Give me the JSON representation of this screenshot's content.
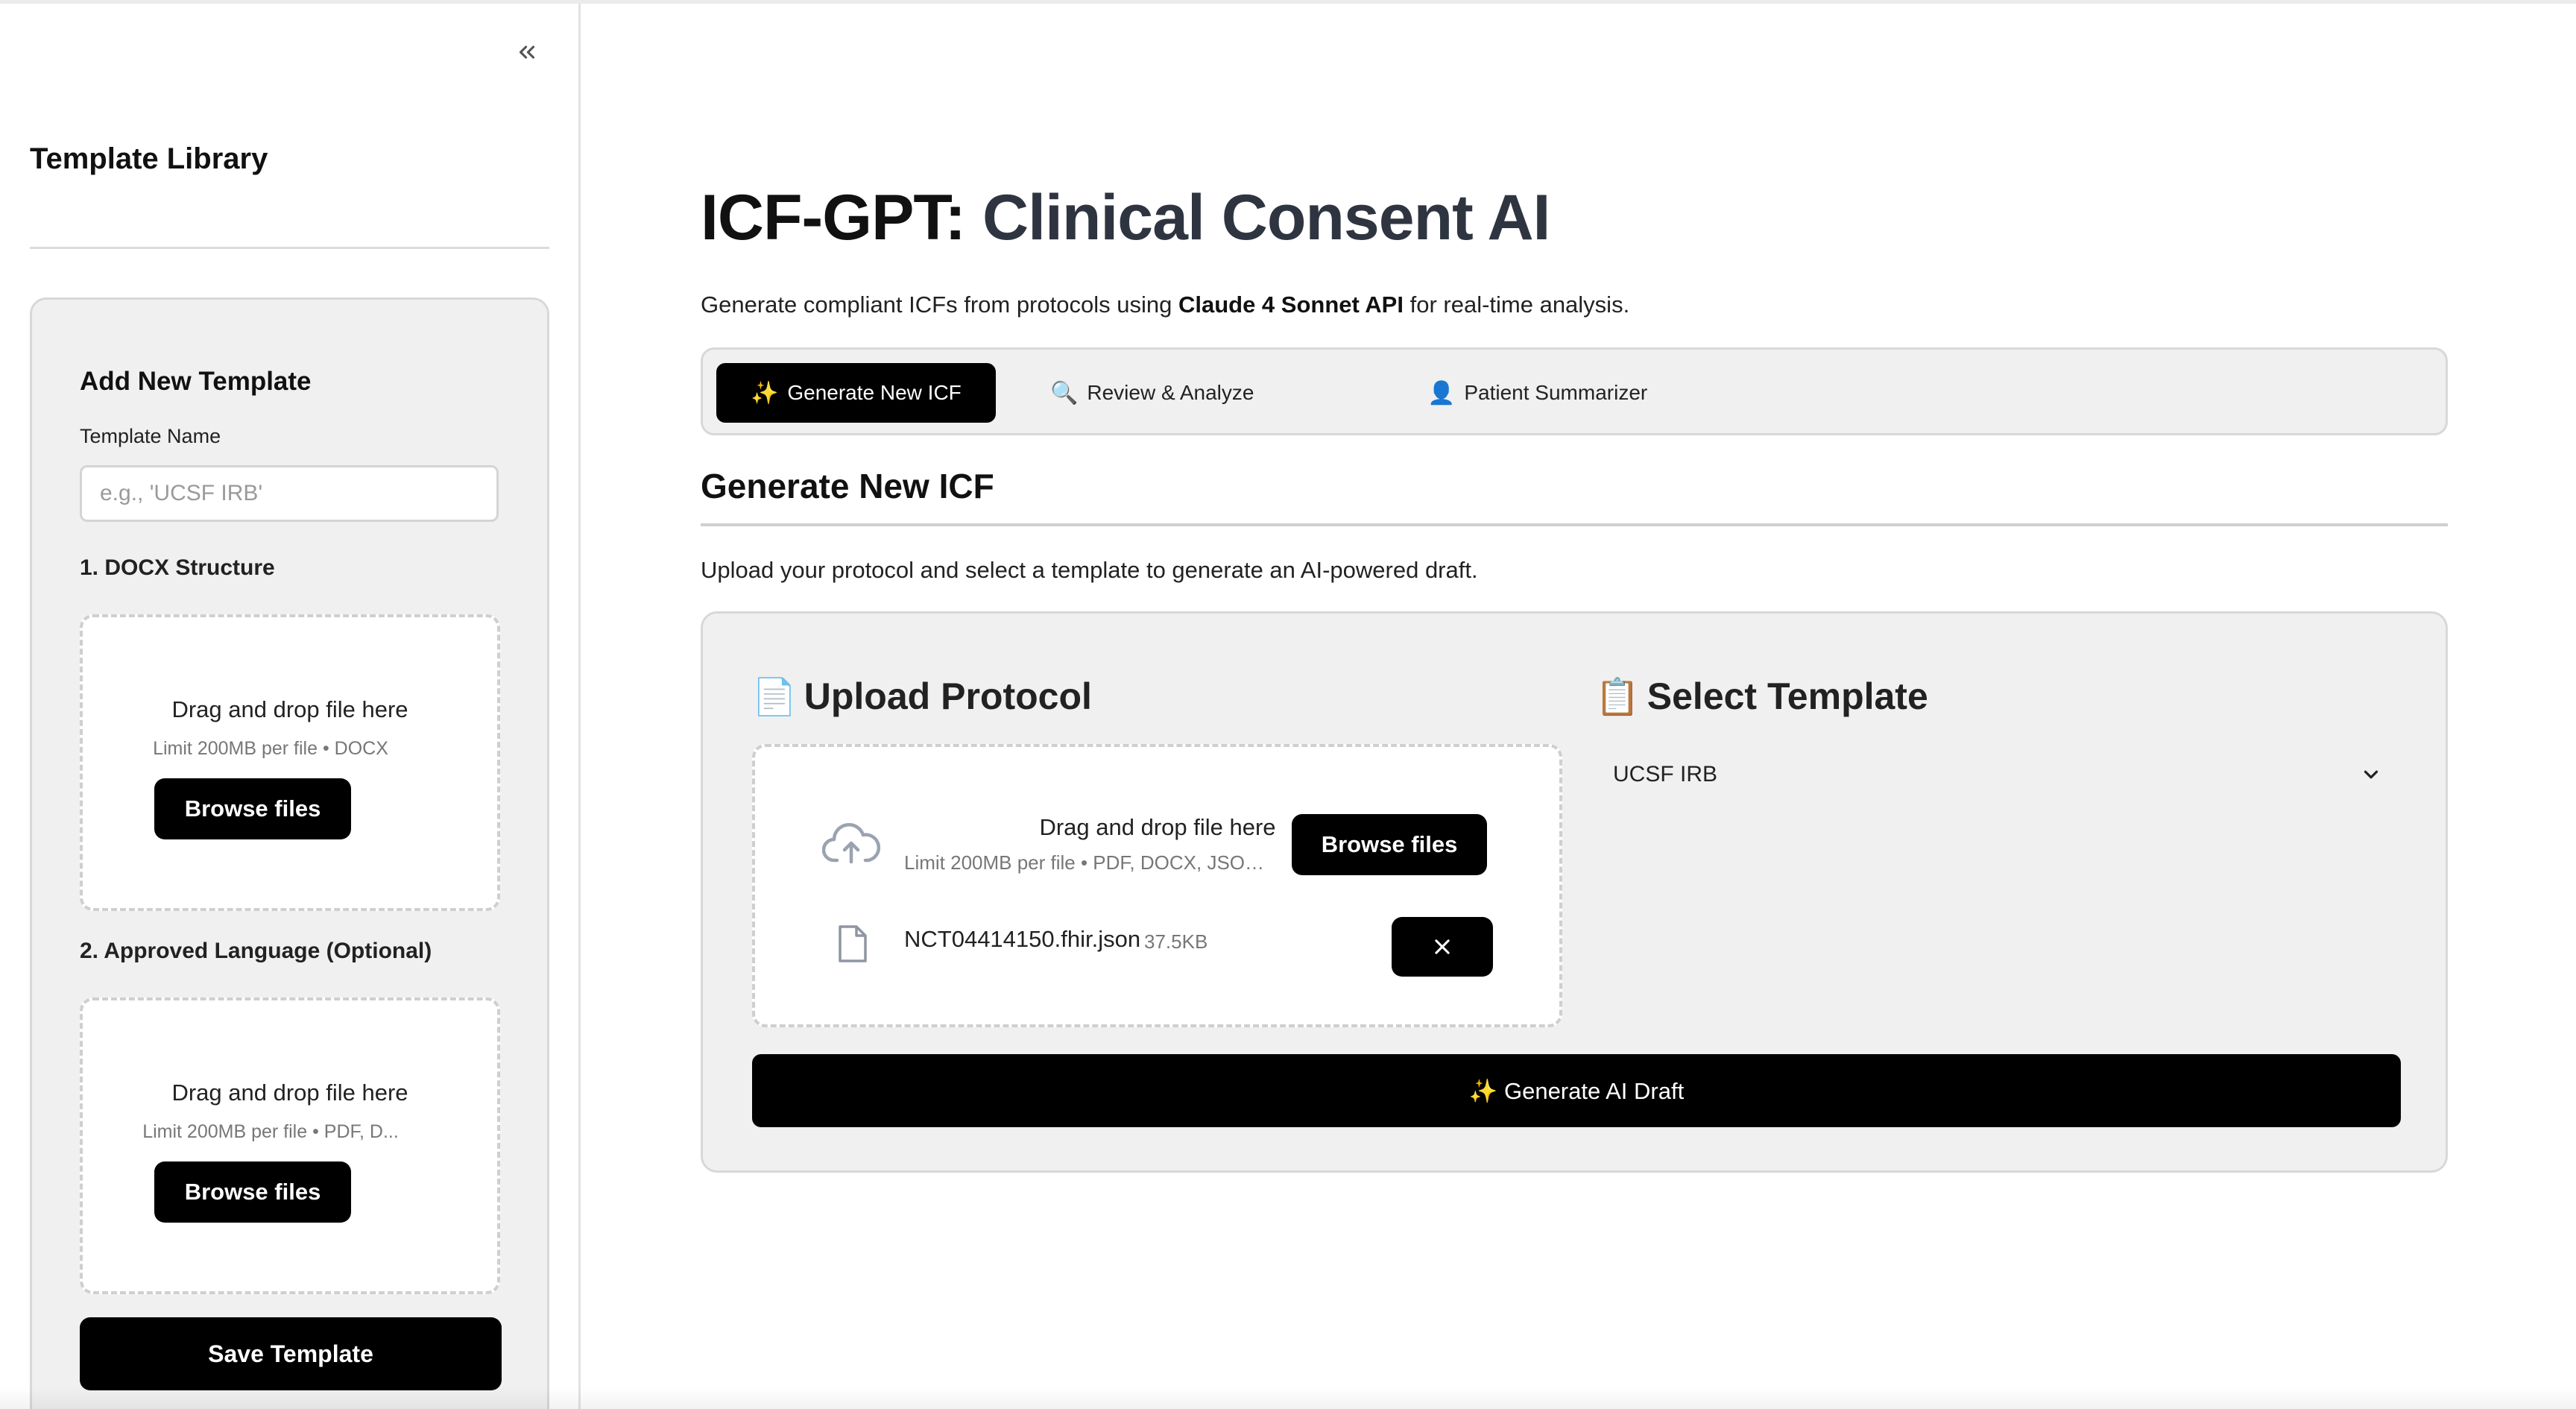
{
  "sidebar": {
    "title": "Template Library",
    "add_template": {
      "heading": "Add New Template",
      "name_label": "Template Name",
      "name_placeholder": "e.g., 'UCSF IRB'",
      "step1_label": "1. DOCX Structure",
      "step1_drop_text": "Drag and drop file here",
      "step1_limit": "Limit 200MB per file • DOCX",
      "step1_browse": "Browse files",
      "step2_label": "2. Approved Language (Optional)",
      "step2_drop_text": "Drag and drop file here",
      "step2_limit": "Limit 200MB per file • PDF, D...",
      "step2_browse": "Browse files",
      "save_label": "Save Template"
    }
  },
  "header": {
    "title_prefix": "ICF-GPT:",
    "title_main": "Clinical Consent AI",
    "subtitle_pre": "Generate compliant ICFs from protocols using",
    "subtitle_bold": "Claude 4 Sonnet API",
    "subtitle_post": "for real-time analysis."
  },
  "tabs": [
    {
      "icon": "✨",
      "label": "Generate New ICF",
      "active": true
    },
    {
      "icon": "🔍",
      "label": "Review & Analyze",
      "active": false
    },
    {
      "icon": "👤",
      "label": "Patient Summarizer",
      "active": false
    }
  ],
  "section": {
    "heading": "Generate New ICF",
    "description": "Upload your protocol and select a template to generate an AI-powered draft."
  },
  "upload": {
    "icon": "📄",
    "heading": "Upload Protocol",
    "drop_text": "Drag and drop file here",
    "limit": "Limit 200MB per file • PDF, DOCX, JSON, ...",
    "browse": "Browse files",
    "file": {
      "name": "NCT04414150.fhir.json",
      "size": "37.5KB"
    }
  },
  "template_select": {
    "icon": "📋",
    "heading": "Select Template",
    "selected": "UCSF IRB"
  },
  "generate_label": "✨ Generate AI Draft",
  "colors": {
    "accent": "#000000",
    "panel": "#f0f0f0",
    "border": "#d8d8d8"
  }
}
